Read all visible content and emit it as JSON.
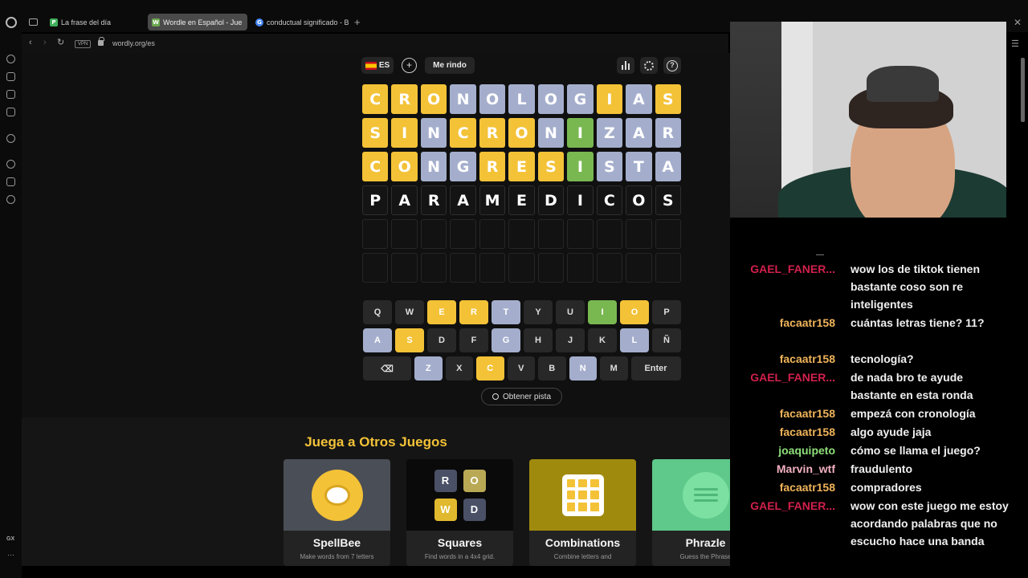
{
  "browser": {
    "tabs": [
      {
        "label": "La frase del día",
        "favicon": "P",
        "favicon_color": "#3fae5a"
      },
      {
        "label": "Wordle en Español - Jue",
        "favicon": "W",
        "favicon_color": "#6aa84f",
        "active": true
      },
      {
        "label": "conductual significado - B",
        "favicon": "G",
        "favicon_color": "#4285f4"
      }
    ],
    "new_tab": "+",
    "vpn": "VPN",
    "url": "wordly.org/es",
    "gx": "GX",
    "more": "···",
    "close": "✕",
    "menu": "☰"
  },
  "game": {
    "language": "ES",
    "add": "+",
    "give_up": "Me rindo",
    "hint": "Obtener pista",
    "board": [
      [
        [
          "C",
          "y"
        ],
        [
          "R",
          "y"
        ],
        [
          "O",
          "y"
        ],
        [
          "N",
          "b"
        ],
        [
          "O",
          "b"
        ],
        [
          "L",
          "b"
        ],
        [
          "O",
          "b"
        ],
        [
          "G",
          "b"
        ],
        [
          "I",
          "y"
        ],
        [
          "A",
          "b"
        ],
        [
          "S",
          "y"
        ]
      ],
      [
        [
          "S",
          "y"
        ],
        [
          "I",
          "y"
        ],
        [
          "N",
          "b"
        ],
        [
          "C",
          "y"
        ],
        [
          "R",
          "y"
        ],
        [
          "O",
          "y"
        ],
        [
          "N",
          "b"
        ],
        [
          "I",
          "g"
        ],
        [
          "Z",
          "b"
        ],
        [
          "A",
          "b"
        ],
        [
          "R",
          "b"
        ]
      ],
      [
        [
          "C",
          "y"
        ],
        [
          "O",
          "y"
        ],
        [
          "N",
          "b"
        ],
        [
          "G",
          "b"
        ],
        [
          "R",
          "y"
        ],
        [
          "E",
          "y"
        ],
        [
          "S",
          "y"
        ],
        [
          "I",
          "g"
        ],
        [
          "S",
          "b"
        ],
        [
          "T",
          "b"
        ],
        [
          "A",
          "b"
        ]
      ],
      [
        [
          "P",
          "e"
        ],
        [
          "A",
          "e"
        ],
        [
          "R",
          "e"
        ],
        [
          "A",
          "e"
        ],
        [
          "M",
          "e"
        ],
        [
          "E",
          "e"
        ],
        [
          "D",
          "e"
        ],
        [
          "I",
          "e"
        ],
        [
          "C",
          "e"
        ],
        [
          "O",
          "e"
        ],
        [
          "S",
          "e"
        ]
      ],
      [
        [
          "",
          "empty"
        ],
        [
          "",
          "empty"
        ],
        [
          "",
          "empty"
        ],
        [
          "",
          "empty"
        ],
        [
          "",
          "empty"
        ],
        [
          "",
          "empty"
        ],
        [
          "",
          "empty"
        ],
        [
          "",
          "empty"
        ],
        [
          "",
          "empty"
        ],
        [
          "",
          "empty"
        ],
        [
          "",
          "empty"
        ]
      ],
      [
        [
          "",
          "empty"
        ],
        [
          "",
          "empty"
        ],
        [
          "",
          "empty"
        ],
        [
          "",
          "empty"
        ],
        [
          "",
          "empty"
        ],
        [
          "",
          "empty"
        ],
        [
          "",
          "empty"
        ],
        [
          "",
          "empty"
        ],
        [
          "",
          "empty"
        ],
        [
          "",
          "empty"
        ],
        [
          "",
          "empty"
        ]
      ]
    ],
    "keyboard": [
      [
        [
          "Q",
          ""
        ],
        [
          "W",
          ""
        ],
        [
          "E",
          "y"
        ],
        [
          "R",
          "y"
        ],
        [
          "T",
          "b"
        ],
        [
          "Y",
          ""
        ],
        [
          "U",
          ""
        ],
        [
          "I",
          "g"
        ],
        [
          "O",
          "y"
        ],
        [
          "P",
          ""
        ]
      ],
      [
        [
          "A",
          "b"
        ],
        [
          "S",
          "y"
        ],
        [
          "D",
          ""
        ],
        [
          "F",
          ""
        ],
        [
          "G",
          "b"
        ],
        [
          "H",
          ""
        ],
        [
          "J",
          ""
        ],
        [
          "K",
          ""
        ],
        [
          "L",
          "b"
        ],
        [
          "Ñ",
          ""
        ]
      ],
      [
        [
          "⌫",
          ""
        ],
        [
          "Z",
          "b"
        ],
        [
          "X",
          ""
        ],
        [
          "C",
          "y"
        ],
        [
          "V",
          ""
        ],
        [
          "B",
          ""
        ],
        [
          "N",
          "b"
        ],
        [
          "M",
          ""
        ],
        [
          "Enter",
          ""
        ]
      ]
    ]
  },
  "other_games": {
    "title": "Juega a Otros Juegos",
    "cards": [
      {
        "title": "SpellBee",
        "desc": "Make words from 7 letters"
      },
      {
        "title": "Squares",
        "desc": "Find words in a 4x4 grid.",
        "tiles": [
          "R",
          "O",
          "W",
          "D"
        ]
      },
      {
        "title": "Combinations",
        "desc": "Combine letters and"
      },
      {
        "title": "Phrazle",
        "desc": "Guess the Phrase"
      }
    ]
  },
  "chat": {
    "dash": "—",
    "messages": [
      {
        "user": "GAEL_FANER...",
        "color": "#d1204c",
        "text": "wow los de tiktok tienen bastante coso son re inteligentes"
      },
      {
        "user": "facaatr158",
        "color": "#f0b45a",
        "text": "cuántas letras tiene? 11?"
      },
      {
        "user": "facaatr158",
        "color": "#f0b45a",
        "text": "tecnología?"
      },
      {
        "user": "GAEL_FANER...",
        "color": "#d1204c",
        "text": "de nada bro te ayude bastante en esta ronda"
      },
      {
        "user": "facaatr158",
        "color": "#f0b45a",
        "text": "empezá con cronología"
      },
      {
        "user": "facaatr158",
        "color": "#f0b45a",
        "text": "algo ayude jaja"
      },
      {
        "user": "joaquipeto",
        "color": "#8fe07a",
        "text": "cómo se llama el juego?"
      },
      {
        "user": "Marvin_wtf",
        "color": "#f2b0c0",
        "text": "fraudulento"
      },
      {
        "user": "facaatr158",
        "color": "#f0b45a",
        "text": "compradores"
      },
      {
        "user": "GAEL_FANER...",
        "color": "#d1204c",
        "text": "wow con este juego me estoy acordando palabras que no escucho hace una banda"
      }
    ]
  }
}
